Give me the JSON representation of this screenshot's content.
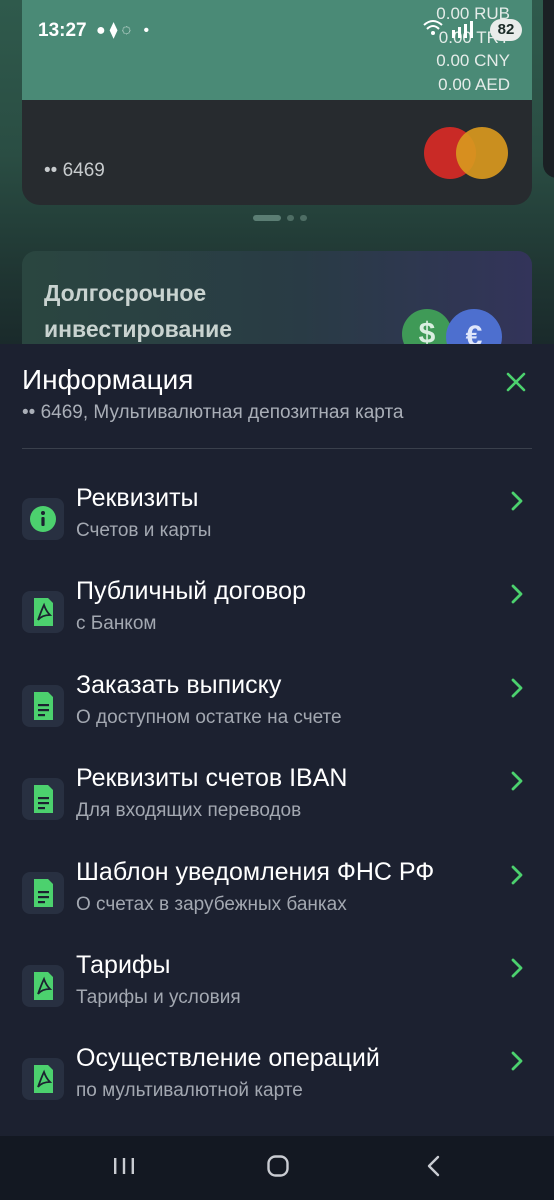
{
  "status_bar": {
    "time": "13:27",
    "notification_icons": "●⧫◌ •",
    "battery": "82"
  },
  "background_app": {
    "balances": [
      "0.00 RUB",
      "0.00 TRY",
      "0.00 CNY",
      "0.00 AED"
    ],
    "card_number": "•• 6469",
    "promo_title_line1": "Долгосрочное",
    "promo_title_line2": "инвестирование",
    "dollar_symbol": "$",
    "euro_symbol": "€"
  },
  "sheet": {
    "title": "Информация",
    "subtitle": "•• 6469, Мультивалютная депозитная карта",
    "items": [
      {
        "label": "Реквизиты",
        "desc": "Счетов и карты",
        "icon": "info-icon"
      },
      {
        "label": "Публичный договор",
        "desc": "с Банком",
        "icon": "pdf-document-icon"
      },
      {
        "label": "Заказать выписку",
        "desc": "О доступном остатке на счете",
        "icon": "text-document-icon"
      },
      {
        "label": "Реквизиты счетов IBAN",
        "desc": "Для входящих переводов",
        "icon": "text-document-icon"
      },
      {
        "label": "Шаблон уведомления ФНС РФ",
        "desc": "О счетах в зарубежных банках",
        "icon": "text-document-icon"
      },
      {
        "label": "Тарифы",
        "desc": "Тарифы и условия",
        "icon": "pdf-document-icon"
      },
      {
        "label": "Осуществление операций",
        "desc": "по мультивалютной карте",
        "icon": "pdf-document-icon"
      }
    ]
  },
  "colors": {
    "accent_green": "#4cd16e",
    "sheet_background": "#1c2130",
    "icon_box": "#283041"
  }
}
